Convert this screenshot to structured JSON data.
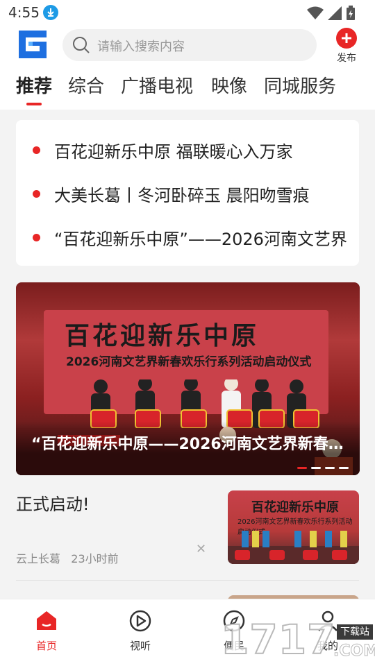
{
  "status": {
    "time": "4:55"
  },
  "header": {
    "search_placeholder": "请输入搜索内容",
    "publish_label": "发布"
  },
  "tabs": [
    {
      "label": "推荐",
      "active": true
    },
    {
      "label": "综合"
    },
    {
      "label": "广播电视"
    },
    {
      "label": "映像"
    },
    {
      "label": "同城服务"
    }
  ],
  "headlines": [
    "百花迎新乐中原 福联暖心入万家",
    "大美长葛丨冬河卧碎玉 晨阳吻雪痕",
    " “百花迎新乐中原”——2026河南文艺界"
  ],
  "banner": {
    "backdrop_title": "百花迎新乐中原",
    "backdrop_subtitle": "2026河南文艺界新春欢乐行系列活动启动仪式",
    "caption": "“百花迎新乐中原——2026河南文艺界新春…",
    "slides": 4,
    "active_slide": 0
  },
  "card": {
    "title": "正式启动!",
    "source": "云上长葛",
    "time": "23小时前",
    "thumb_title": "百花迎新乐中原",
    "thumb_subtitle": "2026河南文艺界新春欢乐行系列活动启动仪式"
  },
  "bottom_nav": [
    {
      "label": "首页",
      "icon": "home-icon",
      "active": true
    },
    {
      "label": "视听",
      "icon": "play-icon"
    },
    {
      "label": "便民",
      "icon": "compass-icon"
    },
    {
      "label": "我的",
      "icon": "user-icon"
    }
  ],
  "watermark": {
    "text": "1717",
    "tag": "下载站",
    "domain": ".COM"
  },
  "colors": {
    "accent": "#e82626",
    "brand_blue": "#1e6fe0"
  }
}
